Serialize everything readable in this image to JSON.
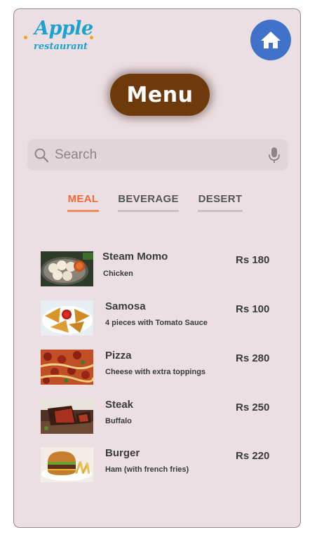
{
  "brand": {
    "top": "Apple",
    "bottom": "restaurant",
    "color": "#1aa3cf",
    "dot_color": "#f3a21d"
  },
  "header": {
    "home_icon": "home-icon",
    "menu_label": "Menu"
  },
  "search": {
    "placeholder": "Search",
    "value": "",
    "icons": [
      "search-icon",
      "mic-icon"
    ]
  },
  "tabs": [
    {
      "label": "MEAL",
      "active": true
    },
    {
      "label": "BEVERAGE",
      "active": false
    },
    {
      "label": "DESERT",
      "active": false
    }
  ],
  "colors": {
    "accent": "#f06a3a",
    "menu_button": "#6e3a0c",
    "home_button": "#3f72c8",
    "background": "#ecdfe3"
  },
  "items": [
    {
      "name": "Steam Momo",
      "desc": "Chicken",
      "price": "Rs 180"
    },
    {
      "name": "Samosa",
      "desc": "4 pieces with Tomato Sauce",
      "price": "Rs 100"
    },
    {
      "name": "Pizza",
      "desc": "Cheese with extra toppings",
      "price": "Rs 280"
    },
    {
      "name": "Steak",
      "desc": "Buffalo",
      "price": "Rs 250"
    },
    {
      "name": "Burger",
      "desc": "Ham (with french fries)",
      "price": "Rs 220"
    }
  ]
}
